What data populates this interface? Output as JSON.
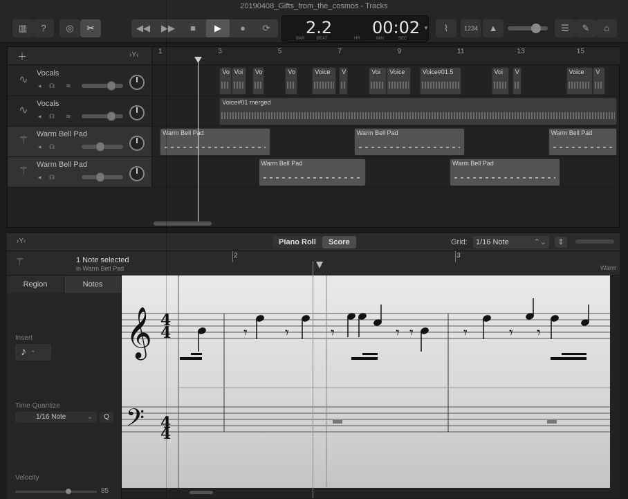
{
  "window": {
    "title": "20190408_Gifts_from_the_cosmos - Tracks"
  },
  "toolbar": {
    "icons": [
      "library-icon",
      "help-icon",
      "smart-controls-icon",
      "scissors-icon",
      "rewind-icon",
      "fast-forward-icon",
      "stop-icon",
      "play-icon",
      "record-icon",
      "cycle-icon",
      "tuner-icon",
      "metronome-icon",
      "master-volume-icon",
      "list-editor-icon",
      "note-pad-icon",
      "browser-icon"
    ],
    "count_in": "1234"
  },
  "lcd": {
    "bar_beat": "2.2",
    "time": "00:02",
    "bar_label": "BAR",
    "beat_label": "BEAT",
    "hr_label": "HR",
    "min_label": "MIN",
    "sec_label": "SEC"
  },
  "ruler": {
    "marks": [
      "1",
      "3",
      "5",
      "7",
      "9",
      "11",
      "13",
      "15"
    ]
  },
  "tracks": [
    {
      "name": "Vocals",
      "type": "audio",
      "fader": 0.72,
      "icon": "waveform-icon"
    },
    {
      "name": "Vocals",
      "type": "audio",
      "fader": 0.72,
      "icon": "waveform-icon"
    },
    {
      "name": "Warm Bell Pad",
      "type": "midi",
      "fader": 0.45,
      "icon": "synth-icon"
    },
    {
      "name": "Warm Bell Pad",
      "type": "midi",
      "fader": 0.45,
      "icon": "synth-icon"
    }
  ],
  "regions": [
    {
      "lane": 0,
      "label": "Vo",
      "start": 3,
      "end": 3.4
    },
    {
      "lane": 0,
      "label": "Voi",
      "start": 3.4,
      "end": 3.9
    },
    {
      "lane": 0,
      "label": "Vo",
      "start": 4.1,
      "end": 4.5
    },
    {
      "lane": 0,
      "label": "Vo",
      "start": 5.2,
      "end": 5.6
    },
    {
      "lane": 0,
      "label": "Voice",
      "start": 6.1,
      "end": 6.9
    },
    {
      "lane": 0,
      "label": "V",
      "start": 7.0,
      "end": 7.3
    },
    {
      "lane": 0,
      "label": "Voi",
      "start": 8.0,
      "end": 8.6
    },
    {
      "lane": 0,
      "label": "Voice",
      "start": 8.6,
      "end": 9.4
    },
    {
      "lane": 0,
      "label": "Voice#01.5",
      "start": 9.7,
      "end": 11.1
    },
    {
      "lane": 0,
      "label": "Voi",
      "start": 12.1,
      "end": 12.7
    },
    {
      "lane": 0,
      "label": "V",
      "start": 12.8,
      "end": 13.1
    },
    {
      "lane": 0,
      "label": "Voice",
      "start": 14.6,
      "end": 15.5
    },
    {
      "lane": 0,
      "label": "V",
      "start": 15.5,
      "end": 15.9
    },
    {
      "lane": 1,
      "label": "Voice#01 merged",
      "start": 3,
      "end": 16.3
    },
    {
      "lane": 2,
      "label": "Warm Bell Pad",
      "start": 1,
      "end": 4.7
    },
    {
      "lane": 2,
      "label": "Warm Bell Pad",
      "start": 7.5,
      "end": 11.2
    },
    {
      "lane": 2,
      "label": "Warm Bell Pad",
      "start": 14.0,
      "end": 16.3
    },
    {
      "lane": 3,
      "label": "Warm Bell Pad",
      "start": 4.3,
      "end": 7.9
    },
    {
      "lane": 3,
      "label": "Warm Bell Pad",
      "start": 10.7,
      "end": 14.4
    }
  ],
  "editor": {
    "tab_piano": "Piano Roll",
    "tab_score": "Score",
    "grid_label": "Grid:",
    "grid_value": "1/16 Note",
    "selected_notes": "1 Note selected",
    "selected_sub": "in Warm Bell Pad",
    "tab_region": "Region",
    "tab_notes": "Notes",
    "insert_label": "Insert",
    "tq_label": "Time Quantize",
    "tq_value": "1/16 Note",
    "q_button": "Q",
    "velocity_label": "Velocity",
    "velocity": "85",
    "ruler_marks": [
      "2",
      "3"
    ],
    "ruler_region": "Warm",
    "time_signature": "4/4"
  }
}
